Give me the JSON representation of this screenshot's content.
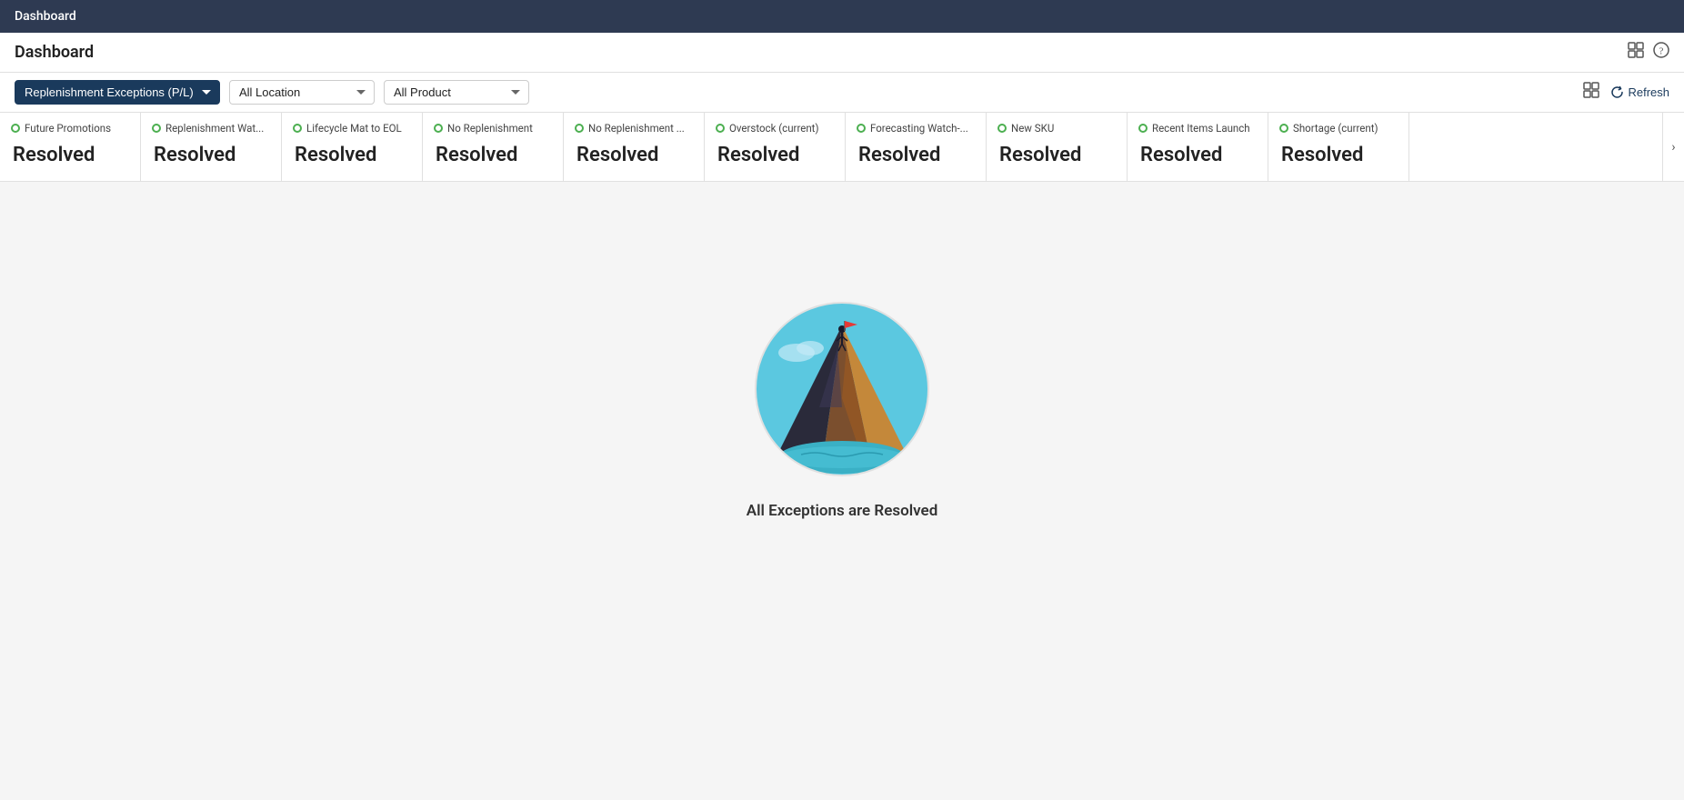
{
  "nav": {
    "title": "Dashboard"
  },
  "header": {
    "title": "Dashboard"
  },
  "toolbar": {
    "filter1": {
      "value": "Replenishment Exceptions (P/L)",
      "options": [
        "Replenishment Exceptions (P/L)"
      ]
    },
    "filter2": {
      "value": "All Location",
      "options": [
        "All Location"
      ]
    },
    "filter3": {
      "value": "All Product",
      "options": [
        "All Product"
      ]
    },
    "refresh_label": "Refresh"
  },
  "cards": [
    {
      "label": "Future Promotions",
      "value": "Resolved"
    },
    {
      "label": "Replenishment Wat...",
      "value": "Resolved"
    },
    {
      "label": "Lifecycle Mat to EOL",
      "value": "Resolved"
    },
    {
      "label": "No Replenishment",
      "value": "Resolved"
    },
    {
      "label": "No Replenishment ...",
      "value": "Resolved"
    },
    {
      "label": "Overstock (current)",
      "value": "Resolved"
    },
    {
      "label": "Forecasting Watch-...",
      "value": "Resolved"
    },
    {
      "label": "New SKU",
      "value": "Resolved"
    },
    {
      "label": "Recent Items Launch",
      "value": "Resolved"
    },
    {
      "label": "Shortage (current)",
      "value": "Resolved"
    }
  ],
  "main": {
    "resolved_message": "All Exceptions are Resolved"
  }
}
